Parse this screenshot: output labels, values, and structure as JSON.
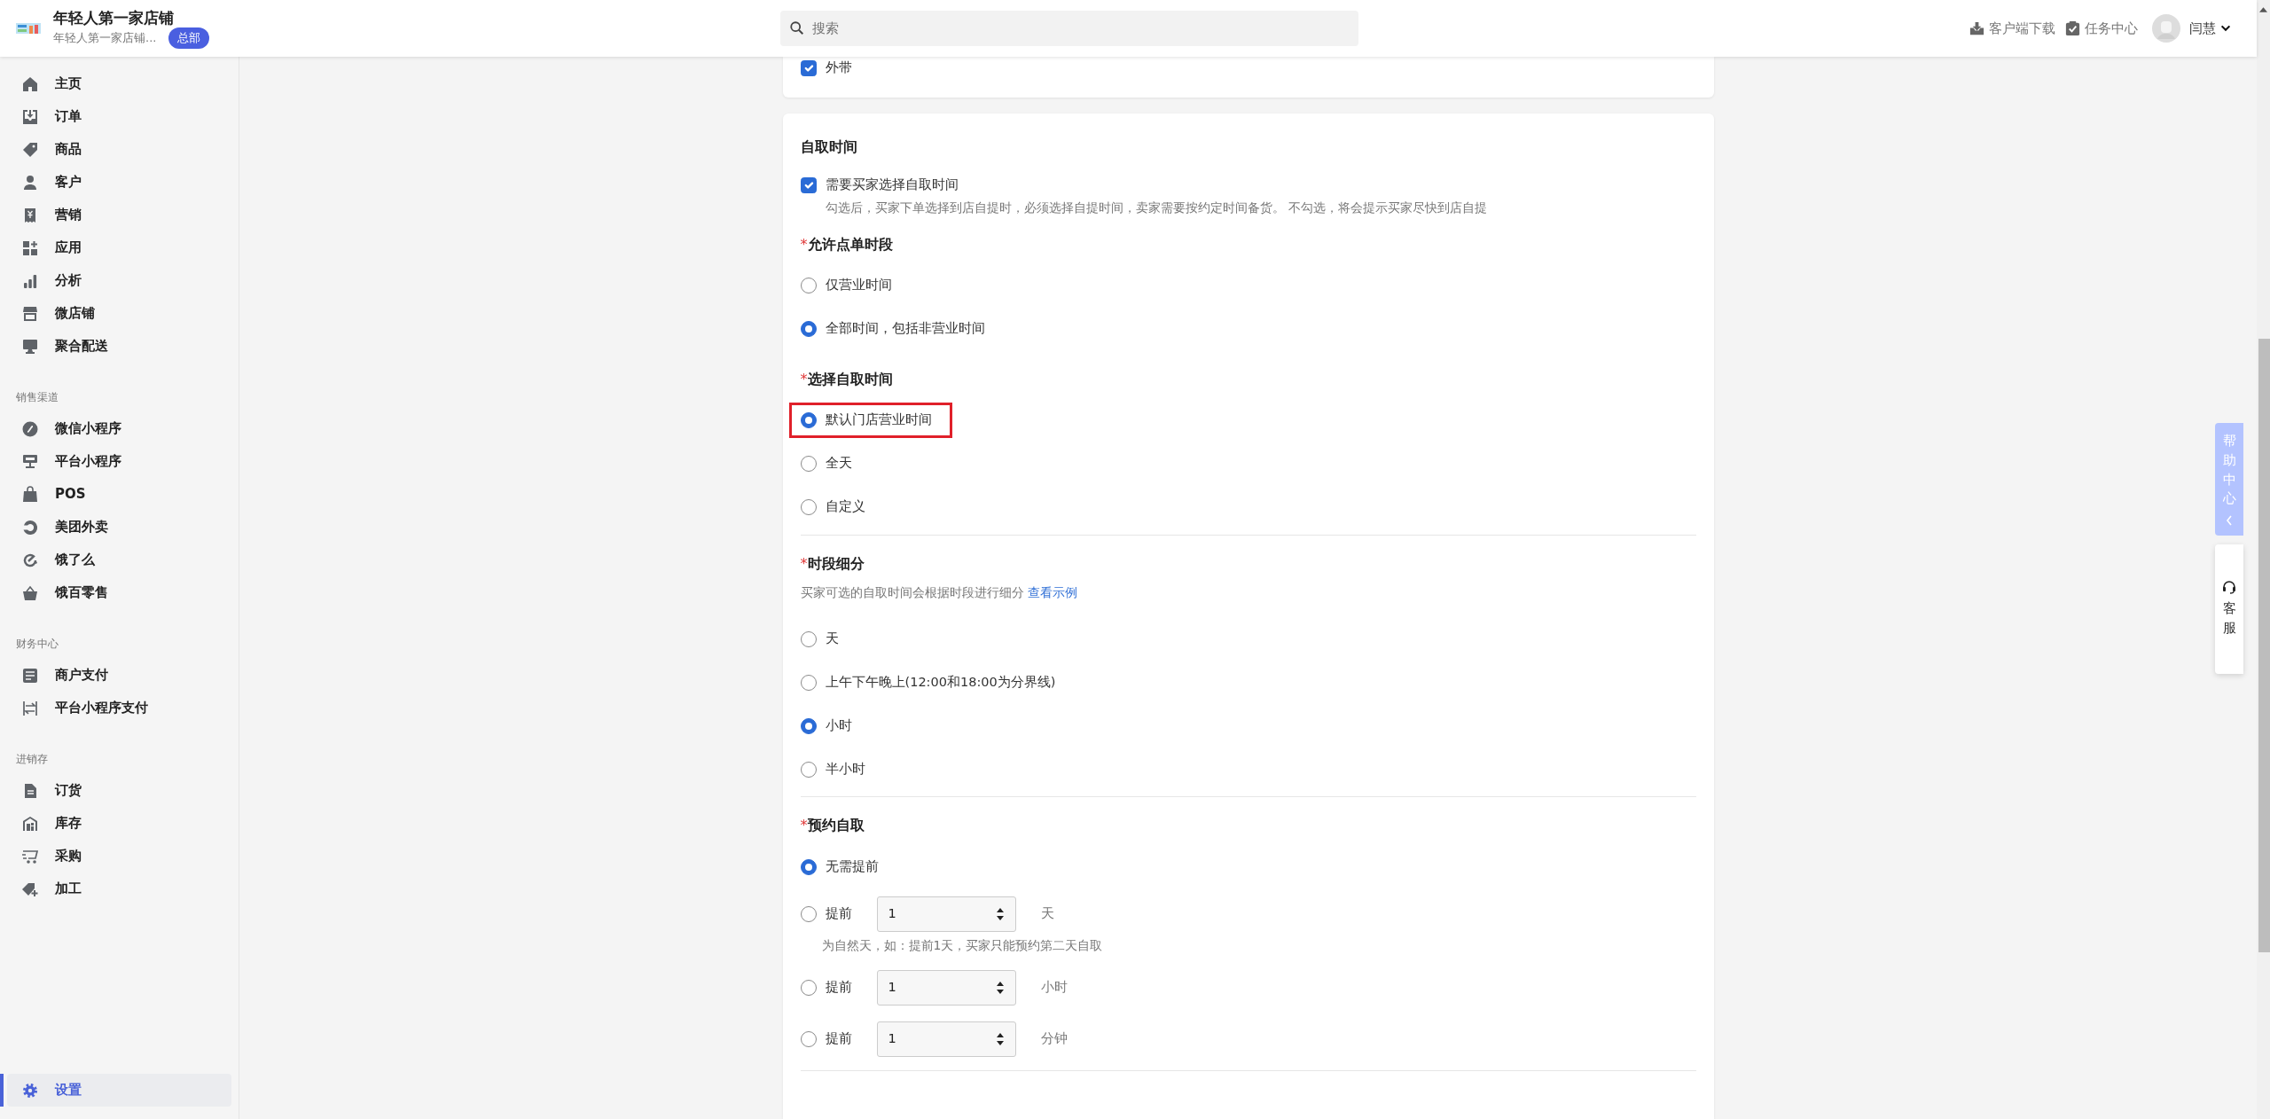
{
  "header": {
    "store_name": "年轻人第一家店铺",
    "store_subtitle": "年轻人第一家店铺...",
    "badge": "总部",
    "search_placeholder": "搜索",
    "links": [
      "客户端下载",
      "任务中心"
    ],
    "user_name": "闫慧"
  },
  "sidebar": {
    "groups": [
      {
        "items": [
          {
            "label": "主页",
            "selected": false
          },
          {
            "label": "订单",
            "selected": false
          },
          {
            "label": "商品",
            "selected": false
          },
          {
            "label": "客户",
            "selected": false
          },
          {
            "label": "营销",
            "selected": false
          },
          {
            "label": "应用",
            "selected": false
          },
          {
            "label": "分析",
            "selected": false
          },
          {
            "label": "微店铺",
            "selected": false
          },
          {
            "label": "聚合配送",
            "selected": false
          }
        ]
      },
      {
        "label": "销售渠道",
        "items": [
          {
            "label": "微信小程序",
            "selected": false
          },
          {
            "label": "平台小程序",
            "selected": false
          },
          {
            "label": "POS",
            "selected": false
          },
          {
            "label": "美团外卖",
            "selected": false
          },
          {
            "label": "饿了么",
            "selected": false
          },
          {
            "label": "饿百零售",
            "selected": false
          }
        ]
      },
      {
        "label": "财务中心",
        "items": [
          {
            "label": "商户支付",
            "selected": false
          },
          {
            "label": "平台小程序支付",
            "selected": false
          }
        ]
      },
      {
        "label": "进销存",
        "items": [
          {
            "label": "订货",
            "selected": false
          },
          {
            "label": "库存",
            "selected": false
          },
          {
            "label": "采购",
            "selected": false
          },
          {
            "label": "加工",
            "selected": false
          }
        ]
      }
    ],
    "footer_item": {
      "label": "设置",
      "selected": true
    }
  },
  "top_card": {
    "checkbox": {
      "label": "外带",
      "checked": true
    }
  },
  "pickup_card": {
    "title": "自取时间",
    "checkbox": {
      "label": "需要买家选择自取时间",
      "checked": true,
      "hint": "勾选后，买家下单选择到店自提时，必须选择自提时间，卖家需要按约定时间备货。 不勾选，将会提示买家尽快到店自提"
    },
    "groups": [
      {
        "required_mark": "*",
        "title": "允许点单时段",
        "divider_below": false,
        "options": [
          {
            "kind": "plain",
            "label": "仅营业时间",
            "selected": false,
            "highlighted": false
          },
          {
            "kind": "plain",
            "label": "全部时间，包括非营业时间",
            "selected": true,
            "highlighted": false
          }
        ]
      },
      {
        "required_mark": "*",
        "title": "选择自取时间",
        "divider_below": true,
        "options": [
          {
            "kind": "plain",
            "label": "默认门店营业时间",
            "selected": true,
            "highlighted": true
          },
          {
            "kind": "plain",
            "label": "全天",
            "selected": false,
            "highlighted": false
          },
          {
            "kind": "plain",
            "label": "自定义",
            "selected": false,
            "highlighted": false
          }
        ]
      },
      {
        "required_mark": "*",
        "title": "时段细分",
        "hint": "买家可选的自取时间会根据时段进行细分",
        "link": "查看示例",
        "divider_below": true,
        "options": [
          {
            "kind": "plain",
            "label": "天",
            "selected": false,
            "highlighted": false
          },
          {
            "kind": "plain",
            "label": "上午下午晚上(12:00和18:00为分界线)",
            "selected": false,
            "highlighted": false
          },
          {
            "kind": "plain",
            "label": "小时",
            "selected": true,
            "highlighted": false
          },
          {
            "kind": "plain",
            "label": "半小时",
            "selected": false,
            "highlighted": false
          }
        ]
      },
      {
        "required_mark": "*",
        "title": "预约自取",
        "divider_below": true,
        "options": [
          {
            "kind": "plain",
            "label": "无需提前",
            "selected": true,
            "highlighted": false
          },
          {
            "kind": "advance",
            "label": "提前",
            "value": "1",
            "unit": "天",
            "note": "为自然天，如：提前1天，买家只能预约第二天自取",
            "selected": false,
            "highlighted": false
          },
          {
            "kind": "advance",
            "label": "提前",
            "value": "1",
            "unit": "小时",
            "selected": false,
            "highlighted": false
          },
          {
            "kind": "advance",
            "label": "提前",
            "value": "1",
            "unit": "分钟",
            "selected": false,
            "highlighted": false
          }
        ]
      }
    ]
  },
  "side_tabs": {
    "help": "帮助中心",
    "service": "客服"
  }
}
